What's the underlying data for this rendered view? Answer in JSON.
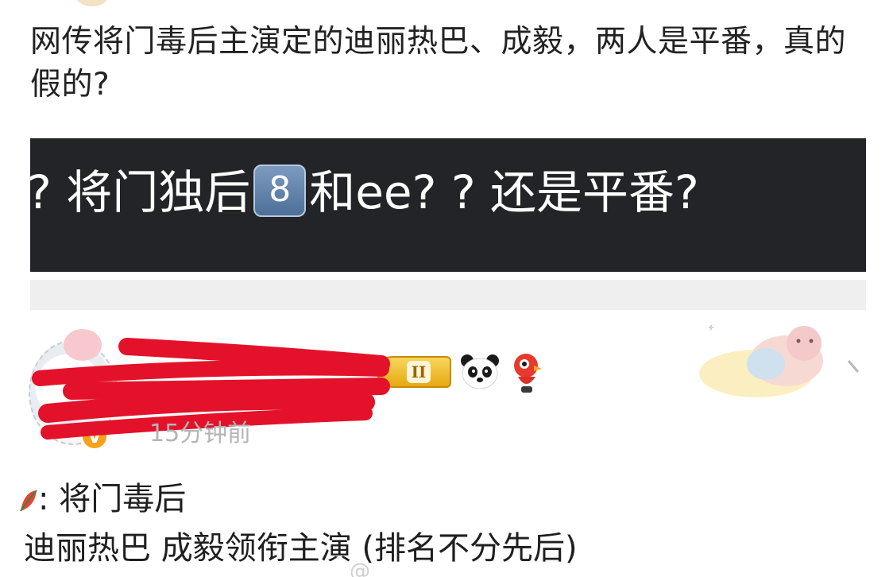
{
  "post": {
    "text": "网传将门毒后主演定的迪丽热巴、成毅，两人是平番，真的假的?"
  },
  "banner": {
    "lead": "?",
    "part1": "将门独后",
    "keycap": "8",
    "part2": "和ee? ? 还是平番?"
  },
  "comment": {
    "username": "",
    "level_badge": "II",
    "verified_badge": "V",
    "time": "15分钟前",
    "line1": ": 将门毒后",
    "line2": "迪丽热巴 成毅领衔主演 (排名不分先后)",
    "watermark": "@"
  },
  "icons": {
    "panda": "panda-emoji-icon",
    "bird": "red-bird-emoji-icon",
    "leaf": "watermelon-leaf-icon",
    "cloud": "cloud-sticker-icon"
  },
  "colors": {
    "banner_bg": "#232428",
    "scribble": "#e3122a",
    "badge_gold": "#e6a912"
  }
}
